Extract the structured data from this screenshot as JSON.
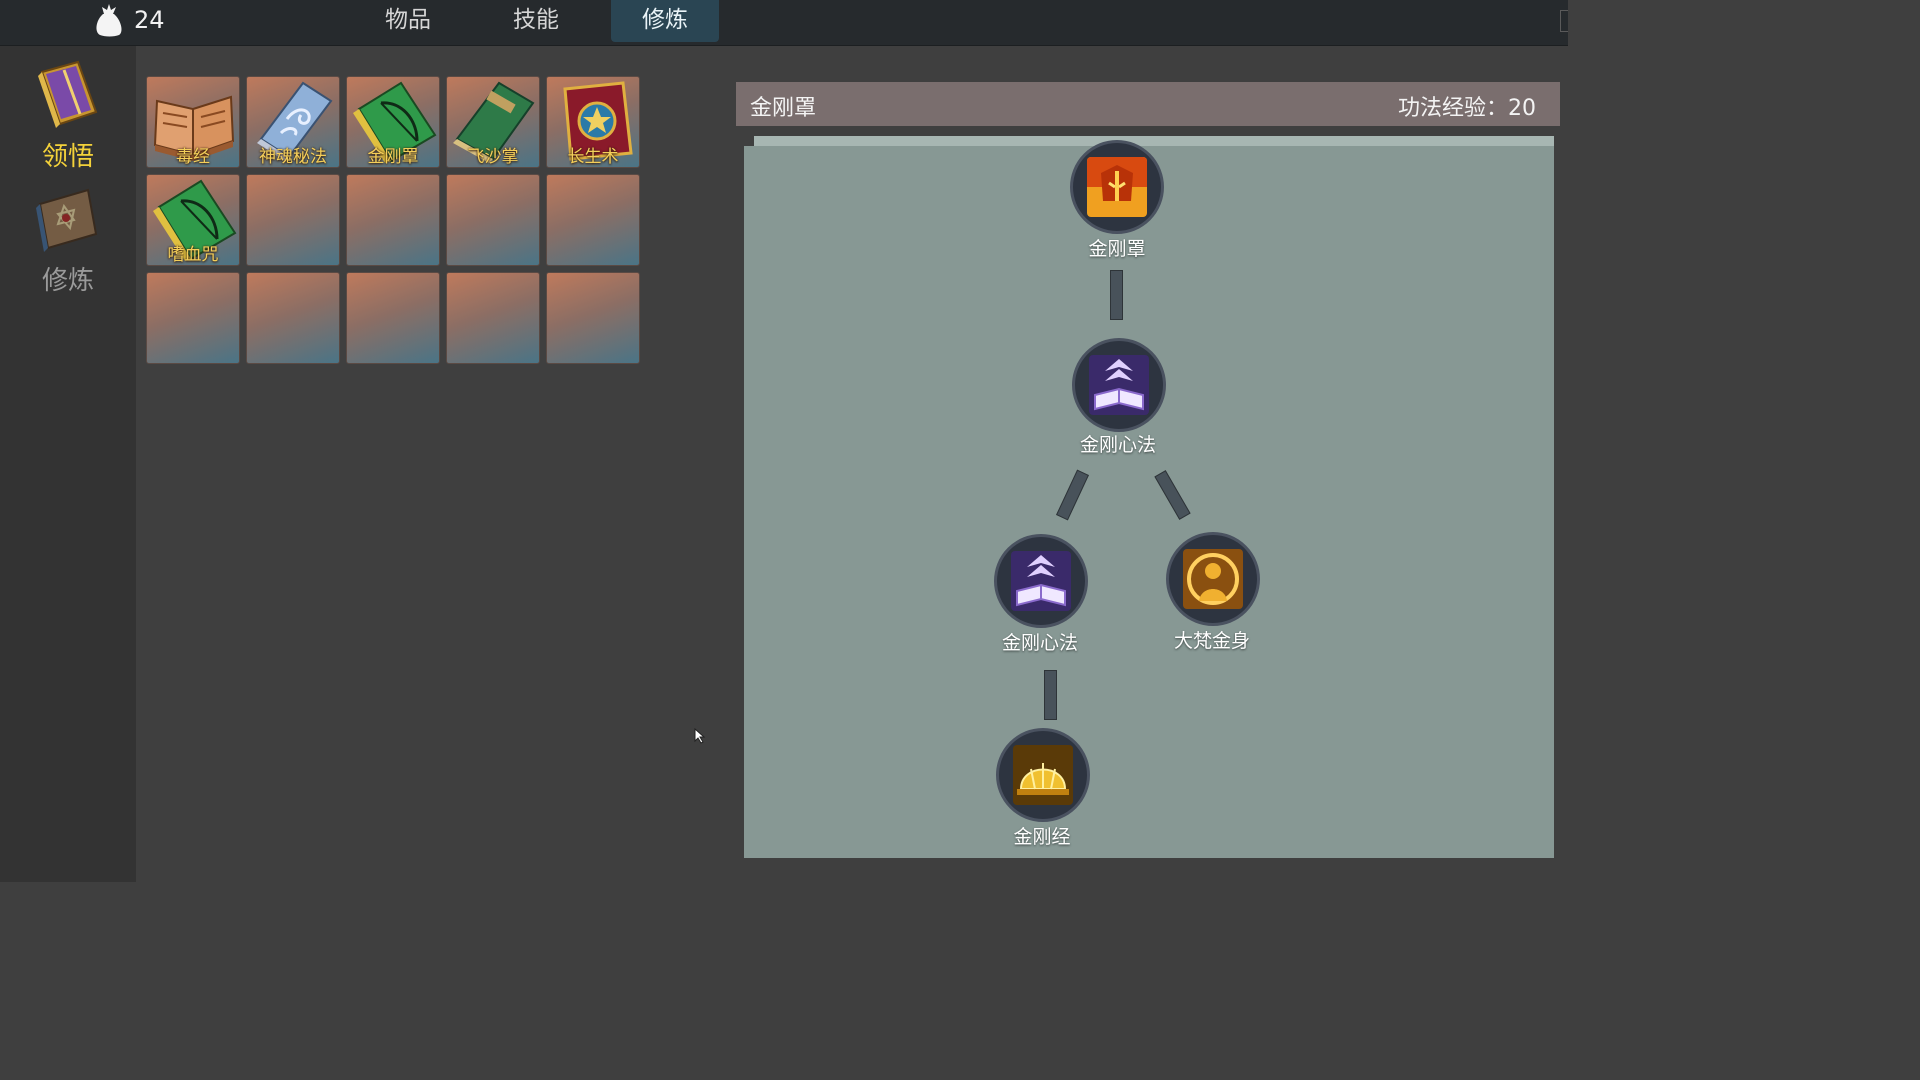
{
  "topbar": {
    "money_icon": "money-bag-icon",
    "money_value": "24",
    "tabs": [
      {
        "label": "物品",
        "active": false
      },
      {
        "label": "技能",
        "active": false
      },
      {
        "label": "修炼",
        "active": true
      }
    ]
  },
  "sidenav": {
    "items": [
      {
        "label": "领悟",
        "icon": "golden-scroll-book-icon",
        "active": true,
        "color": "#f4d23a"
      },
      {
        "label": "修炼",
        "icon": "blue-hexagram-book-icon",
        "active": false,
        "color": "#9a9a9a"
      }
    ]
  },
  "inventory": {
    "items": [
      {
        "name": "毒经",
        "icon": "open-brown-book-icon"
      },
      {
        "name": "神魂秘法",
        "icon": "blue-swirl-book-icon"
      },
      {
        "name": "金刚罩",
        "icon": "green-bow-book-icon"
      },
      {
        "name": "飞沙掌",
        "icon": "green-rune-book-icon"
      },
      {
        "name": "长生术",
        "icon": "red-star-book-icon"
      },
      {
        "name": "嗜血咒",
        "icon": "green-bow-book-icon"
      }
    ],
    "empty_slots": 9
  },
  "skill_panel": {
    "title": "金刚罩",
    "exp_text": "功法经验：20",
    "nodes": [
      {
        "label": "金刚罩",
        "icon": "fire-helmet-icon"
      },
      {
        "label": "金刚心法",
        "icon": "purple-upgrade-book-icon"
      },
      {
        "label": "金刚心法",
        "icon": "purple-upgrade-book-icon"
      },
      {
        "label": "大梵金身",
        "icon": "golden-monk-icon"
      },
      {
        "label": "金刚经",
        "icon": "golden-dome-icon"
      }
    ]
  },
  "colors": {
    "accent_active_tab": "#2a4553",
    "active_nav_label": "#f4d23a",
    "item_label": "#f4cf5a",
    "tree_background": "#879894",
    "panel_header": "#7a6e6e"
  }
}
